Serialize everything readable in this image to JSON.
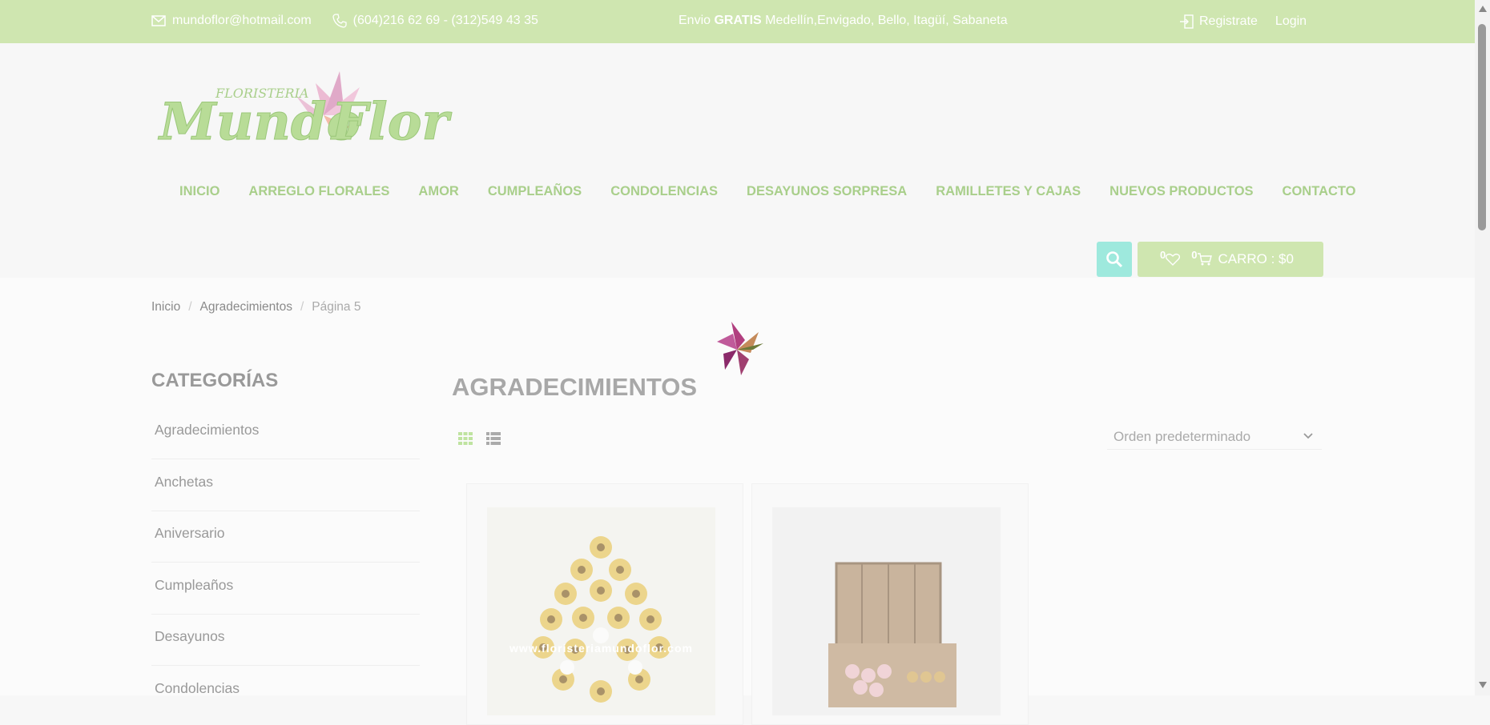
{
  "topbar": {
    "email": "mundoflor@hotmail.com",
    "phone": "(604)216 62 69 - (312)549 43 35",
    "promo_prefix": "Envio ",
    "promo_bold": "GRATIS",
    "promo_rest": " Medellín,Envigado, Bello, Itagüí, Sabaneta",
    "register": "Registrate",
    "login": "Login"
  },
  "logo": {
    "small": "FLORISTERIA",
    "brand": "Mundo Flor"
  },
  "nav": {
    "items": [
      {
        "label": "INICIO"
      },
      {
        "label": "ARREGLO FLORALES"
      },
      {
        "label": "AMOR"
      },
      {
        "label": "CUMPLEAÑOS"
      },
      {
        "label": "CONDOLENCIAS"
      },
      {
        "label": "DESAYUNOS SORPRESA"
      },
      {
        "label": "RAMILLETES Y CAJAS"
      },
      {
        "label": "NUEVOS PRODUCTOS"
      },
      {
        "label": "CONTACTO"
      }
    ]
  },
  "cart": {
    "wishlist_count": "0",
    "cart_count": "0",
    "label": "CARRO : $0"
  },
  "breadcrumb": {
    "home": "Inicio",
    "category": "Agradecimientos",
    "current": "Página 5"
  },
  "sidebar": {
    "title": "CATEGORÍAS",
    "items": [
      "Agradecimientos",
      "Anchetas",
      "Aniversario",
      "Cumpleaños",
      "Desayunos",
      "Condolencias"
    ]
  },
  "main": {
    "title": "AGRADECIMIENTOS",
    "sort_value": "Orden predeterminado",
    "watermark": "www.floristeriamundoflor.com"
  },
  "colors": {
    "topbar": "#cfe6b0",
    "nav": "#a9cf8b",
    "search": "#9ee9dd"
  }
}
